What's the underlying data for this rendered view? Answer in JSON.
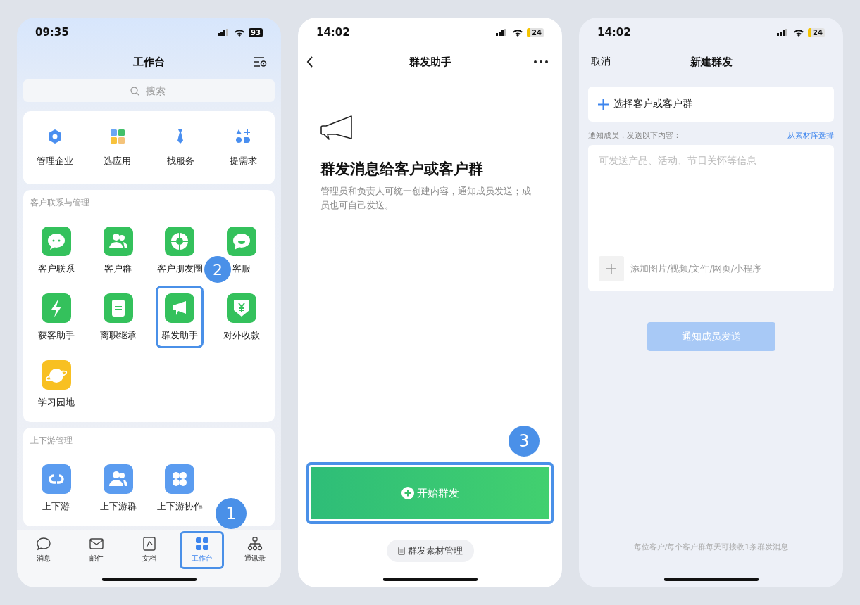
{
  "workbench_screen": {
    "status_bar": {
      "time": "09:35",
      "battery": "93"
    },
    "title": "工作台",
    "search": {
      "placeholder": "搜索"
    },
    "quick_actions": [
      {
        "label": "管理企业"
      },
      {
        "label": "选应用"
      },
      {
        "label": "找服务"
      },
      {
        "label": "提需求"
      }
    ],
    "sections": [
      {
        "title": "客户联系与管理",
        "apps": [
          {
            "label": "客户联系",
            "highlighted": false
          },
          {
            "label": "客户群",
            "highlighted": false
          },
          {
            "label": "客户朋友圈",
            "highlighted": false
          },
          {
            "label": "客服",
            "highlighted": false
          },
          {
            "label": "获客助手",
            "highlighted": false
          },
          {
            "label": "离职继承",
            "highlighted": false
          },
          {
            "label": "群发助手",
            "highlighted": true
          },
          {
            "label": "对外收款",
            "highlighted": false
          },
          {
            "label": "学习园地",
            "highlighted": false
          }
        ],
        "step_badge": "2"
      },
      {
        "title": "上下游管理",
        "apps": [
          {
            "label": "上下游",
            "highlighted": false
          },
          {
            "label": "上下游群",
            "highlighted": false
          },
          {
            "label": "上下游协作",
            "highlighted": false
          }
        ]
      }
    ],
    "tabs": [
      {
        "label": "消息",
        "selected": false,
        "highlighted": false
      },
      {
        "label": "邮件",
        "selected": false,
        "highlighted": false
      },
      {
        "label": "文档",
        "selected": false,
        "highlighted": false
      },
      {
        "label": "工作台",
        "selected": true,
        "highlighted": true
      },
      {
        "label": "通讯录",
        "selected": false,
        "highlighted": false
      }
    ],
    "step_badge": "1"
  },
  "broadcast_screen": {
    "status_bar": {
      "time": "14:02",
      "battery": "24"
    },
    "title": "群发助手",
    "headline": "群发消息给客户或客户群",
    "description": "管理员和负责人可统一创建内容，通知成员发送；成员也可自己发送。",
    "start_button": {
      "label": "开始群发",
      "highlighted": true
    },
    "step_badge": "3",
    "materials_button": "群发素材管理"
  },
  "new_broadcast_screen": {
    "status_bar": {
      "time": "14:02",
      "battery": "24"
    },
    "cancel": "取消",
    "title": "新建群发",
    "select_recipients": "选择客户或客户群",
    "content_label": "通知成员，发送以下内容：",
    "library_link": "从素材库选择",
    "message": {
      "placeholder": "可发送产品、活动、节日关怀等信息"
    },
    "attach_hint": "添加图片/视频/文件/网页/小程序",
    "send_button": {
      "label": "通知成员发送",
      "disabled": true
    },
    "footer_note": "每位客户/每个客户群每天可接收1条群发消息"
  }
}
